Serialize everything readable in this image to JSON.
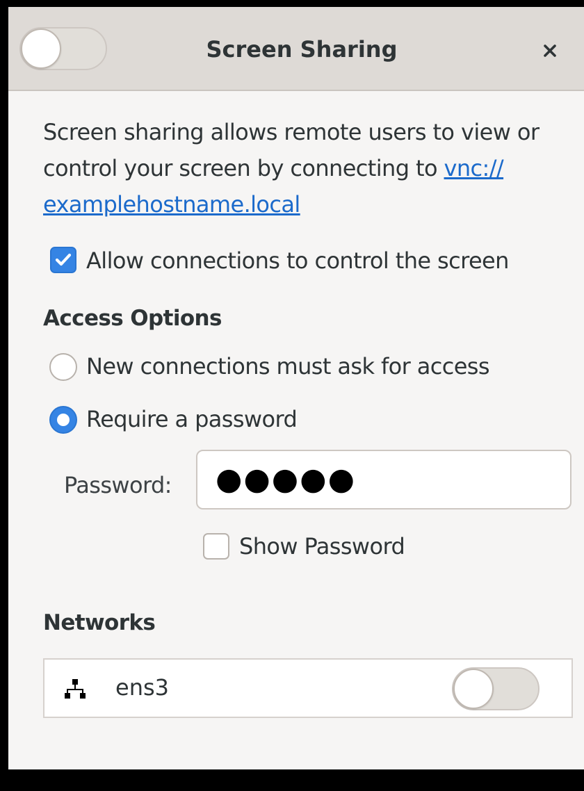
{
  "window": {
    "title": "Screen Sharing",
    "sharing_enabled": false,
    "close_icon": "close-icon"
  },
  "description": {
    "text": "Screen sharing allows remote users to view or control your screen by connecting to ",
    "link_text": "vnc://\nexamplehostname.local"
  },
  "allow_control": {
    "label": "Allow connections to control the screen",
    "checked": true
  },
  "access_options": {
    "heading": "Access Options",
    "options": [
      {
        "label": "New connections must ask for access",
        "selected": false
      },
      {
        "label": "Require a password",
        "selected": true
      }
    ]
  },
  "password": {
    "label": "Password:",
    "value": "●●●●●"
  },
  "show_password": {
    "label": "Show Password",
    "checked": false
  },
  "networks": {
    "heading": "Networks",
    "items": [
      {
        "name": "ens3",
        "icon": "network-wired-icon",
        "enabled": false
      }
    ]
  },
  "colors": {
    "accent": "#3584e4",
    "link": "#1b6acb",
    "headerbar": "#dedad6",
    "background": "#f6f5f4"
  }
}
